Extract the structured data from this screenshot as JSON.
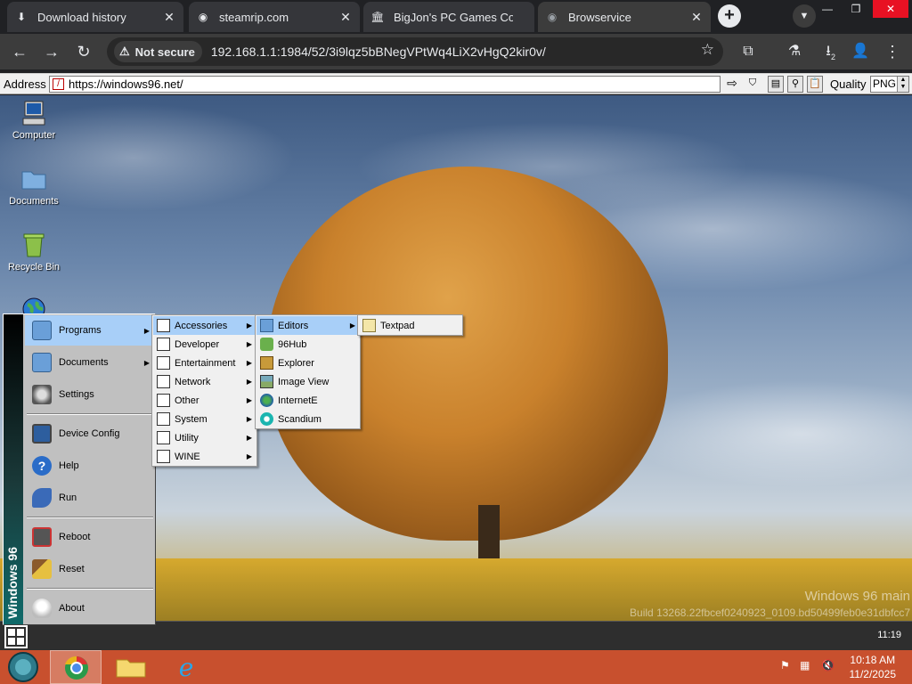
{
  "browser": {
    "tabs": [
      {
        "title": "Download history",
        "icon": "download-icon"
      },
      {
        "title": "steamrip.com",
        "icon": "globe-icon"
      },
      {
        "title": "BigJon's PC Games Coll",
        "icon": "bank-icon"
      },
      {
        "title": "Browservice",
        "icon": "globe-icon",
        "active": true
      }
    ],
    "security_label": "Not secure",
    "url": "192.168.1.1:1984/52/3i9lqz5bBNegVPtWq4LiX2vHgQ2kir0v/",
    "download_count": "2"
  },
  "browservice": {
    "address_label": "Address",
    "address_value": "https://windows96.net/",
    "quality_label": "Quality",
    "quality_value": "PNG"
  },
  "desktop": {
    "icons": [
      {
        "label": "Computer",
        "icon": "computer-icon"
      },
      {
        "label": "Documents",
        "icon": "folder-icon"
      },
      {
        "label": "Recycle Bin",
        "icon": "recycle-bin-icon"
      }
    ],
    "watermark_line1": "Windows 96 main",
    "watermark_line2": "Build 13268.22fbcef0240923_0109.bd50499feb0e31dbfcc7",
    "taskbar_clock": "11:19"
  },
  "start_menu": {
    "brand": "Windows 96",
    "items": [
      {
        "label": "Programs",
        "icon": "folder-icon",
        "submenu": true
      },
      {
        "label": "Documents",
        "icon": "folder-icon",
        "submenu": true
      },
      {
        "label": "Settings",
        "icon": "settings-icon"
      },
      {
        "label": "Device Config",
        "icon": "monitor-icon"
      },
      {
        "label": "Help",
        "icon": "help-icon"
      },
      {
        "label": "Run",
        "icon": "run-icon"
      },
      {
        "label": "Reboot",
        "icon": "reboot-icon"
      },
      {
        "label": "Reset",
        "icon": "broom-icon"
      },
      {
        "label": "About",
        "icon": "lightbulb-icon"
      }
    ],
    "programs": [
      "Accessories",
      "Developer",
      "Entertainment",
      "Network",
      "Other",
      "System",
      "Utility",
      "WINE"
    ],
    "accessories": [
      "Editors",
      "96Hub",
      "Explorer",
      "Image View",
      "InternetE",
      "Scandium"
    ],
    "editors": [
      "Textpad"
    ]
  },
  "host": {
    "clock_time": "10:18 AM",
    "clock_date": "11/2/2025"
  }
}
